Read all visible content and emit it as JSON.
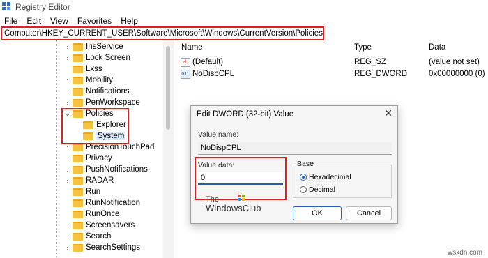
{
  "window": {
    "title": "Registry Editor"
  },
  "menu": [
    "File",
    "Edit",
    "View",
    "Favorites",
    "Help"
  ],
  "address": "Computer\\HKEY_CURRENT_USER\\Software\\Microsoft\\Windows\\CurrentVersion\\Policies\\System",
  "tree": {
    "items": [
      {
        "label": "IrisService",
        "chevron": "›"
      },
      {
        "label": "Lock Screen",
        "chevron": "›"
      },
      {
        "label": "Lxss",
        "chevron": ""
      },
      {
        "label": "Mobility",
        "chevron": "›"
      },
      {
        "label": "Notifications",
        "chevron": "›"
      },
      {
        "label": "PenWorkspace",
        "chevron": "›"
      },
      {
        "label": "Policies",
        "chevron": "⌄"
      },
      {
        "label": "Explorer",
        "chevron": ""
      },
      {
        "label": "System",
        "chevron": "",
        "selected": true
      },
      {
        "label": "PrecisionTouchPad",
        "chevron": "›"
      },
      {
        "label": "Privacy",
        "chevron": "›"
      },
      {
        "label": "PushNotifications",
        "chevron": "›"
      },
      {
        "label": "RADAR",
        "chevron": "›"
      },
      {
        "label": "Run",
        "chevron": ""
      },
      {
        "label": "RunNotification",
        "chevron": ""
      },
      {
        "label": "RunOnce",
        "chevron": ""
      },
      {
        "label": "Screensavers",
        "chevron": "›"
      },
      {
        "label": "Search",
        "chevron": "›"
      },
      {
        "label": "SearchSettings",
        "chevron": "›"
      }
    ]
  },
  "list": {
    "columns": [
      "Name",
      "Type",
      "Data"
    ],
    "rows": [
      {
        "icon": "ab",
        "name": "(Default)",
        "type": "REG_SZ",
        "data": "(value not set)"
      },
      {
        "icon": "011",
        "name": "NoDispCPL",
        "type": "REG_DWORD",
        "data": "0x00000000 (0)"
      }
    ]
  },
  "dialog": {
    "title": "Edit DWORD (32-bit) Value",
    "close": "✕",
    "value_name_label": "Value name:",
    "value_name": "NoDispCPL",
    "value_data_label": "Value data:",
    "value_data": "0",
    "base_label": "Base",
    "base_options": [
      "Hexadecimal",
      "Decimal"
    ],
    "base_selected": "Hexadecimal",
    "ok": "OK",
    "cancel": "Cancel"
  },
  "watermark": {
    "line1": "The",
    "line2": "WindowsClub"
  },
  "credit": "wsxdn.com",
  "colors": {
    "highlight": "#e02020",
    "accent": "#1f5fbf",
    "folder": "#f5c242"
  }
}
